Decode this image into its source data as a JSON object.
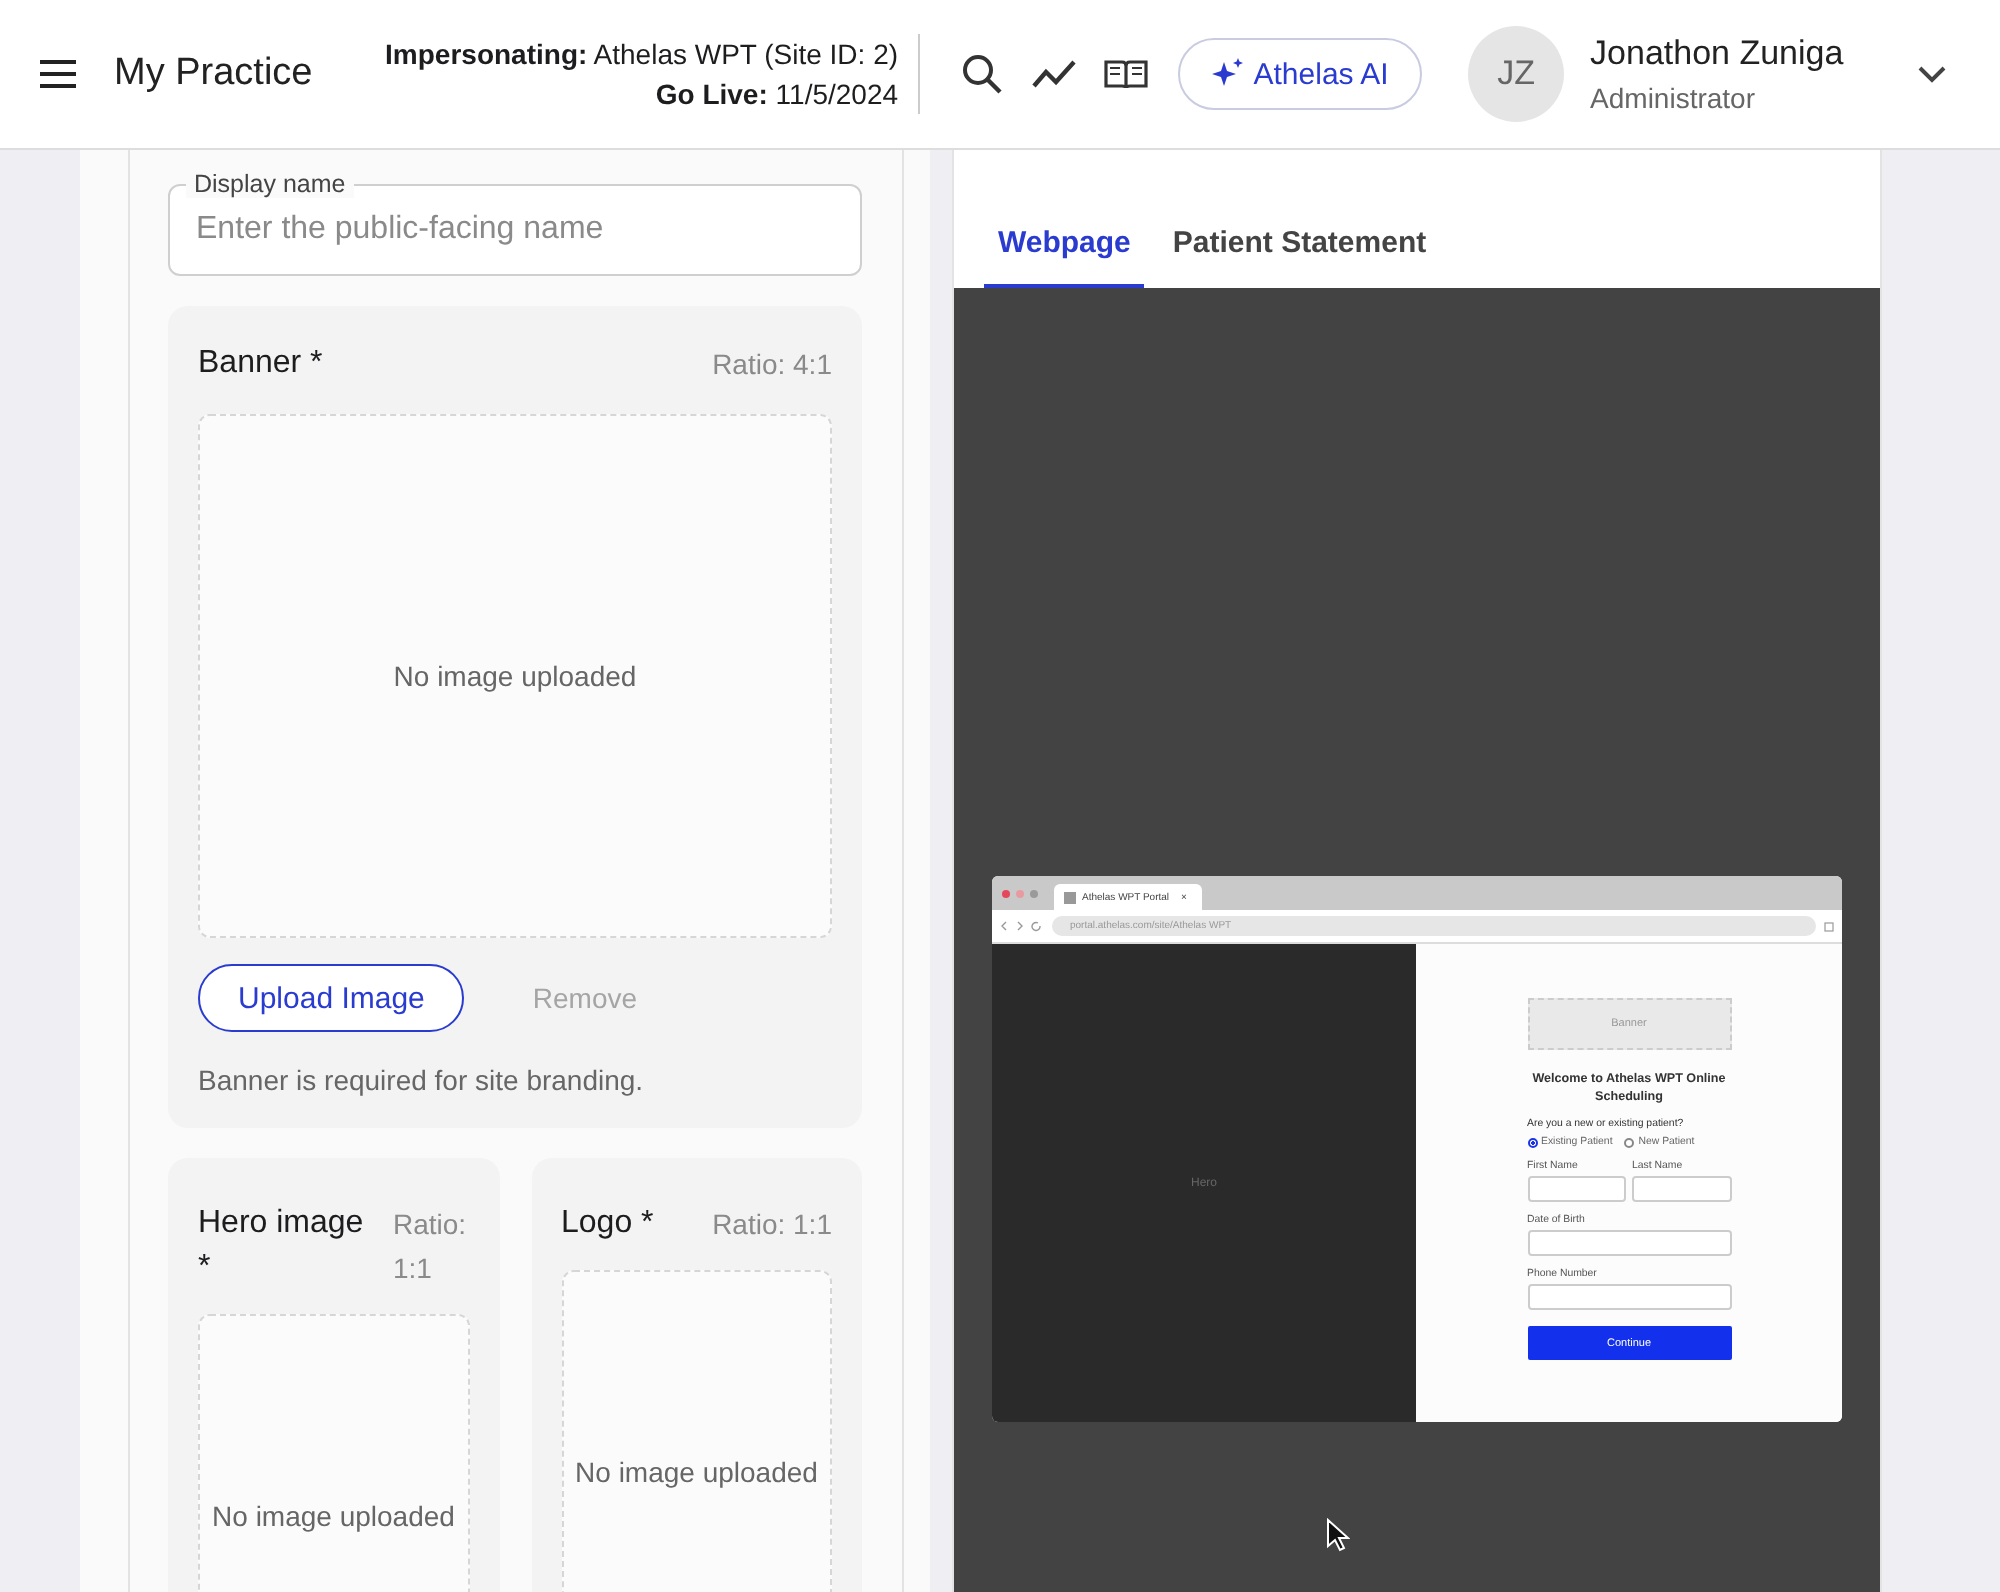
{
  "header": {
    "app_title": "My Practice",
    "impersonation": {
      "label": "Impersonating:",
      "value": "Athelas WPT (Site ID: 2)"
    },
    "go_live": {
      "label": "Go Live:",
      "value": "11/5/2024"
    },
    "ai_button": "Athelas AI",
    "user": {
      "initials": "JZ",
      "name": "Jonathon Zuniga",
      "role": "Administrator"
    }
  },
  "form": {
    "display_name": {
      "label": "Display name",
      "placeholder": "Enter the public-facing name"
    },
    "banner": {
      "title": "Banner *",
      "ratio": "Ratio: 4:1",
      "empty": "No image uploaded",
      "upload_button": "Upload Image",
      "remove_button": {
        "label": "Remove",
        "disabled": true
      },
      "helper": "Banner is required for site branding."
    },
    "images": [
      {
        "title": "Hero image *",
        "ratio": "Ratio: 1:1",
        "empty": "No image uploaded"
      },
      {
        "title": "Logo *",
        "ratio": "Ratio: 1:1",
        "empty": "No image uploaded"
      }
    ]
  },
  "preview": {
    "tabs": [
      {
        "label": "Webpage",
        "selected": true
      },
      {
        "label": "Patient Statement",
        "selected": false
      }
    ],
    "mockup": {
      "tab_title": "Athelas WPT Portal",
      "tab_close": "×",
      "url": "portal.athelas.com/site/Athelas WPT",
      "hero": "Hero",
      "banner": "Banner",
      "heading": "Welcome to Athelas WPT Online Scheduling",
      "question": "Are you a new or existing patient?",
      "radios": [
        {
          "label": "Existing Patient",
          "selected": true
        },
        {
          "label": "New Patient",
          "selected": false
        }
      ],
      "fields": [
        {
          "label": "First Name"
        },
        {
          "label": "Last Name"
        },
        {
          "label": "Date of Birth"
        },
        {
          "label": "Phone Number"
        }
      ],
      "button": "Continue"
    }
  }
}
